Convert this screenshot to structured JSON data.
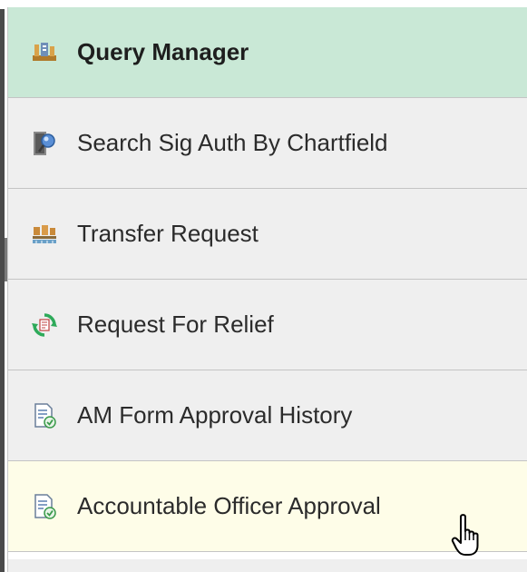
{
  "menu": {
    "items": [
      {
        "label": "Query Manager",
        "icon": "query-manager-icon",
        "state": "active"
      },
      {
        "label": "Search Sig Auth By Chartfield",
        "icon": "search-door-icon",
        "state": "normal"
      },
      {
        "label": "Transfer Request",
        "icon": "transfer-icon",
        "state": "normal"
      },
      {
        "label": "Request For Relief",
        "icon": "refresh-cycle-icon",
        "state": "normal"
      },
      {
        "label": "AM Form Approval History",
        "icon": "document-check-icon",
        "state": "normal"
      },
      {
        "label": "Accountable Officer Approval",
        "icon": "document-check-icon",
        "state": "hover"
      }
    ]
  },
  "colors": {
    "active_bg": "#c9e8d6",
    "item_bg": "#efefef",
    "hover_bg": "#fefde8",
    "divider": "#c4c4c4"
  },
  "cursor": "hand-pointer-icon"
}
